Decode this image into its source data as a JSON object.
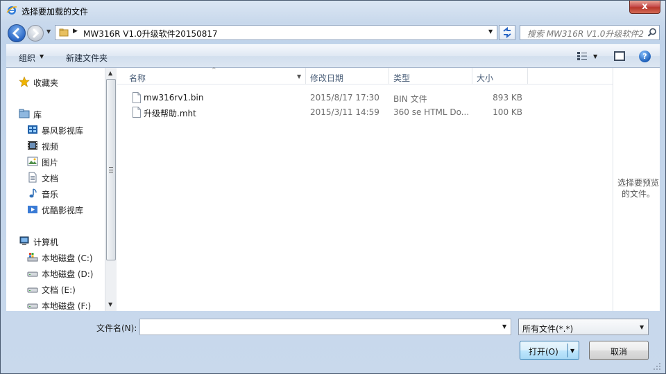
{
  "window": {
    "title": "选择要加载的文件",
    "close_glyph": "x"
  },
  "address": {
    "path": "MW316R V1.0升级软件20150817"
  },
  "search": {
    "placeholder": "搜索 MW316R V1.0升级软件20150817"
  },
  "toolbar": {
    "organize": "组织",
    "new_folder": "新建文件夹",
    "help": "?"
  },
  "nav": {
    "favorites": "收藏夹",
    "libraries": "库",
    "library_items": [
      "暴风影视库",
      "视频",
      "图片",
      "文档",
      "音乐",
      "优酷影视库"
    ],
    "computer": "计算机",
    "drives": [
      "本地磁盘 (C:)",
      "本地磁盘 (D:)",
      "文档 (E:)",
      "本地磁盘 (F:)"
    ]
  },
  "columns": {
    "name": "名称",
    "date": "修改日期",
    "type": "类型",
    "size": "大小"
  },
  "files": [
    {
      "name": "mw316rv1.bin",
      "date": "2015/8/17 17:30",
      "type": "BIN 文件",
      "size": "893 KB"
    },
    {
      "name": "升级帮助.mht",
      "date": "2015/3/11 14:59",
      "type": "360 se HTML Do...",
      "size": "100 KB"
    }
  ],
  "preview": {
    "message": "选择要预览的文件。"
  },
  "footer": {
    "filename_label": "文件名(N):",
    "filename_value": "",
    "filter": "所有文件(*.*)",
    "open": "打开(O)",
    "cancel": "取消"
  },
  "icons": {
    "title": "ie-icon",
    "back": "back-arrow-icon",
    "forward": "forward-arrow-icon",
    "refresh": "refresh-icon",
    "search": "search-icon",
    "view": "view-options-icon",
    "pane": "preview-pane-icon"
  },
  "colors": {
    "accent": "#2a66c4",
    "open_button": "#bee6fd",
    "close_button": "#c75050"
  }
}
